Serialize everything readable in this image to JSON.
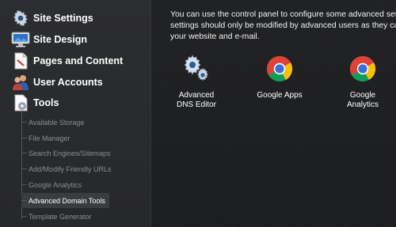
{
  "sidebar": {
    "items": [
      {
        "label": "Site Settings",
        "icon": "gear-icon"
      },
      {
        "label": "Site Design",
        "icon": "monitor-icon"
      },
      {
        "label": "Pages and Content",
        "icon": "document-icon"
      },
      {
        "label": "User Accounts",
        "icon": "users-icon"
      },
      {
        "label": "Tools",
        "icon": "tools-icon"
      }
    ],
    "tools_submenu": [
      "Available Storage",
      "File Manager",
      "Search Engines/Sitemaps",
      "Add/Modify Friendly URLs",
      "Google Analytics",
      "Advanced Domain Tools",
      "Template Generator"
    ],
    "active_submenu": "Advanced Domain Tools"
  },
  "main": {
    "intro_lines": [
      "You can use the control panel to configure some advanced settings",
      "settings should only be modified by advanced users as they can a",
      "your website and e-mail."
    ],
    "tools": [
      {
        "label_line1": "Advanced",
        "label_line2": "DNS Editor",
        "icon": "gears-icon"
      },
      {
        "label_line1": "Google Apps",
        "label_line2": "",
        "icon": "chrome-icon"
      },
      {
        "label_line1": "Google",
        "label_line2": "Analytics",
        "icon": "chrome-icon"
      }
    ]
  },
  "colors": {
    "sidebar_bg": "#2c2d30",
    "main_bg": "#1c1d1f",
    "active_bg": "#3b3c40",
    "sub_text": "#8b8d92"
  }
}
